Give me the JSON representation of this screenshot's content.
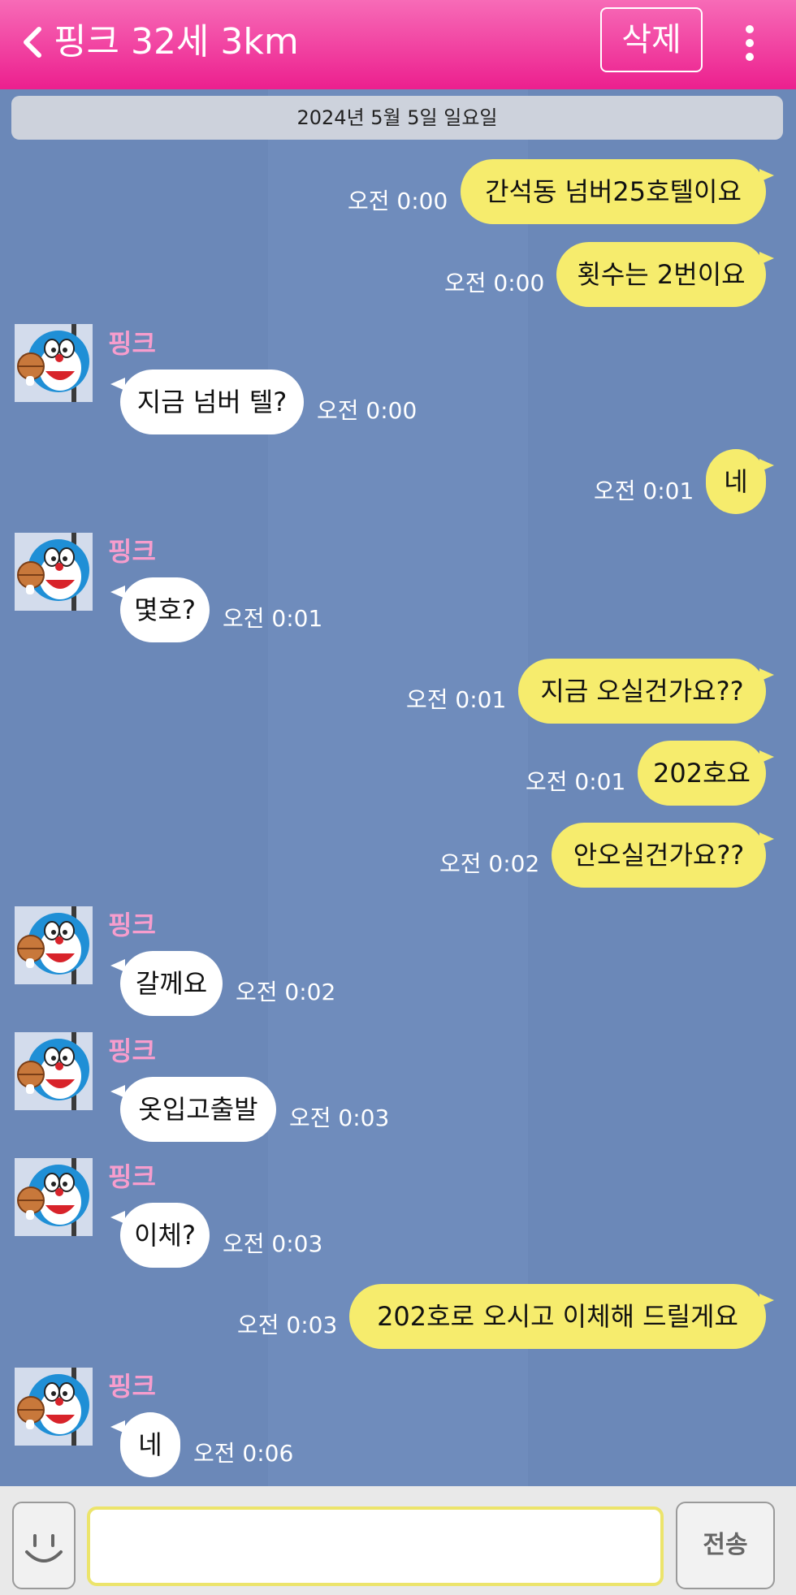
{
  "header": {
    "title": "핑크 32세 3km",
    "delete_label": "삭제"
  },
  "date_divider": "2024년 5월 5일 일요일",
  "messages": [
    {
      "from": "me",
      "text": "간석동 넘버25호텔이요",
      "time": "오전 0:00"
    },
    {
      "from": "me",
      "text": "횟수는 2번이요",
      "time": "오전 0:00"
    },
    {
      "from": "other",
      "sender": "핑크",
      "text": "지금 넘버 텔?",
      "time": "오전 0:00"
    },
    {
      "from": "me",
      "text": "네",
      "time": "오전 0:01"
    },
    {
      "from": "other",
      "sender": "핑크",
      "text": "몇호?",
      "time": "오전 0:01"
    },
    {
      "from": "me",
      "text": "지금 오실건가요??",
      "time": "오전 0:01"
    },
    {
      "from": "me",
      "text": "202호요",
      "time": "오전 0:01"
    },
    {
      "from": "me",
      "text": "안오실건가요??",
      "time": "오전 0:02"
    },
    {
      "from": "other",
      "sender": "핑크",
      "text": "갈께요",
      "time": "오전 0:02"
    },
    {
      "from": "other",
      "sender": "핑크",
      "text": "옷입고출발",
      "time": "오전 0:03"
    },
    {
      "from": "other",
      "sender": "핑크",
      "text": "이체?",
      "time": "오전 0:03"
    },
    {
      "from": "me",
      "text": "202호로 오시고 이체해 드릴게요",
      "time": "오전 0:03"
    },
    {
      "from": "other",
      "sender": "핑크",
      "text": "네",
      "time": "오전 0:06"
    }
  ],
  "composer": {
    "input_value": "",
    "send_label": "전송"
  },
  "colors": {
    "header": "#ec1f8e",
    "background": "#6b88b8",
    "my_bubble": "#f6ec6d",
    "other_bubble": "#ffffff",
    "sender_name": "#f79dcd"
  },
  "icons": {
    "back": "chevron-left-icon",
    "more": "more-vertical-icon",
    "emoji": "smiley-icon",
    "avatar": "cartoon-cat-avatar"
  }
}
